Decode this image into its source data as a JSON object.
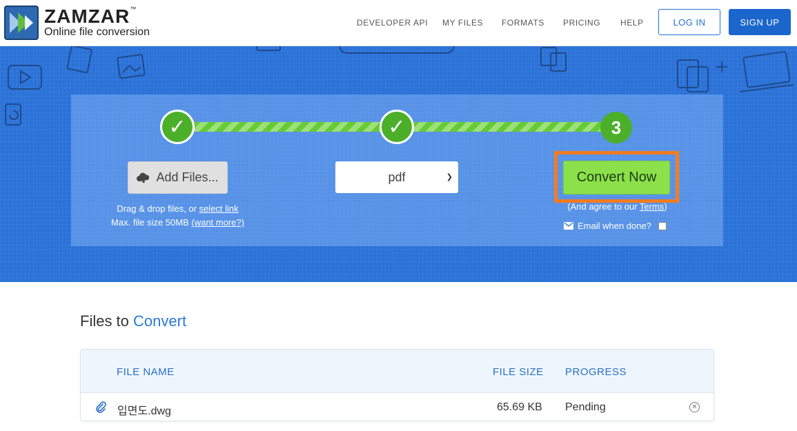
{
  "brand": {
    "name": "ZAMZAR",
    "trademark": "™",
    "tagline": "Online file conversion",
    "colors": {
      "primary": "#1a66cc",
      "accent_green": "#8ce04a",
      "step_green": "#4caf2a",
      "highlight_orange": "#f47c20",
      "hero_blue": "#2a72d8"
    }
  },
  "nav": {
    "links": [
      "DEVELOPER API",
      "MY FILES",
      "FORMATS",
      "PRICING",
      "HELP"
    ],
    "login": "LOG IN",
    "signup": "SIGN UP"
  },
  "converter": {
    "steps": [
      {
        "state": "complete",
        "icon": "check-icon"
      },
      {
        "state": "complete",
        "icon": "check-icon"
      },
      {
        "state": "current",
        "label": "3"
      }
    ],
    "add_files_label": "Add Files...",
    "add_files_icon": "cloud-upload-icon",
    "drag_text": "Drag & drop files, or",
    "select_link": "select link",
    "max_size_text": "Max. file size 50MB",
    "want_more_link": "(want more?)",
    "format_selected": "pdf",
    "convert_label": "Convert Now",
    "agree_prefix": "(And agree to our",
    "terms_link": "Terms",
    "agree_suffix": ")",
    "email_label": "Email when done?",
    "email_icon": "envelope-icon",
    "email_checked": false
  },
  "files": {
    "title_prefix": "Files to",
    "title_accent": "Convert",
    "columns": [
      "FILE NAME",
      "FILE SIZE",
      "PROGRESS"
    ],
    "rows": [
      {
        "icon": "paperclip-icon",
        "name": "입면도.dwg",
        "size": "65.69 KB",
        "progress": "Pending",
        "remove_icon": "close-circle-icon"
      }
    ]
  }
}
